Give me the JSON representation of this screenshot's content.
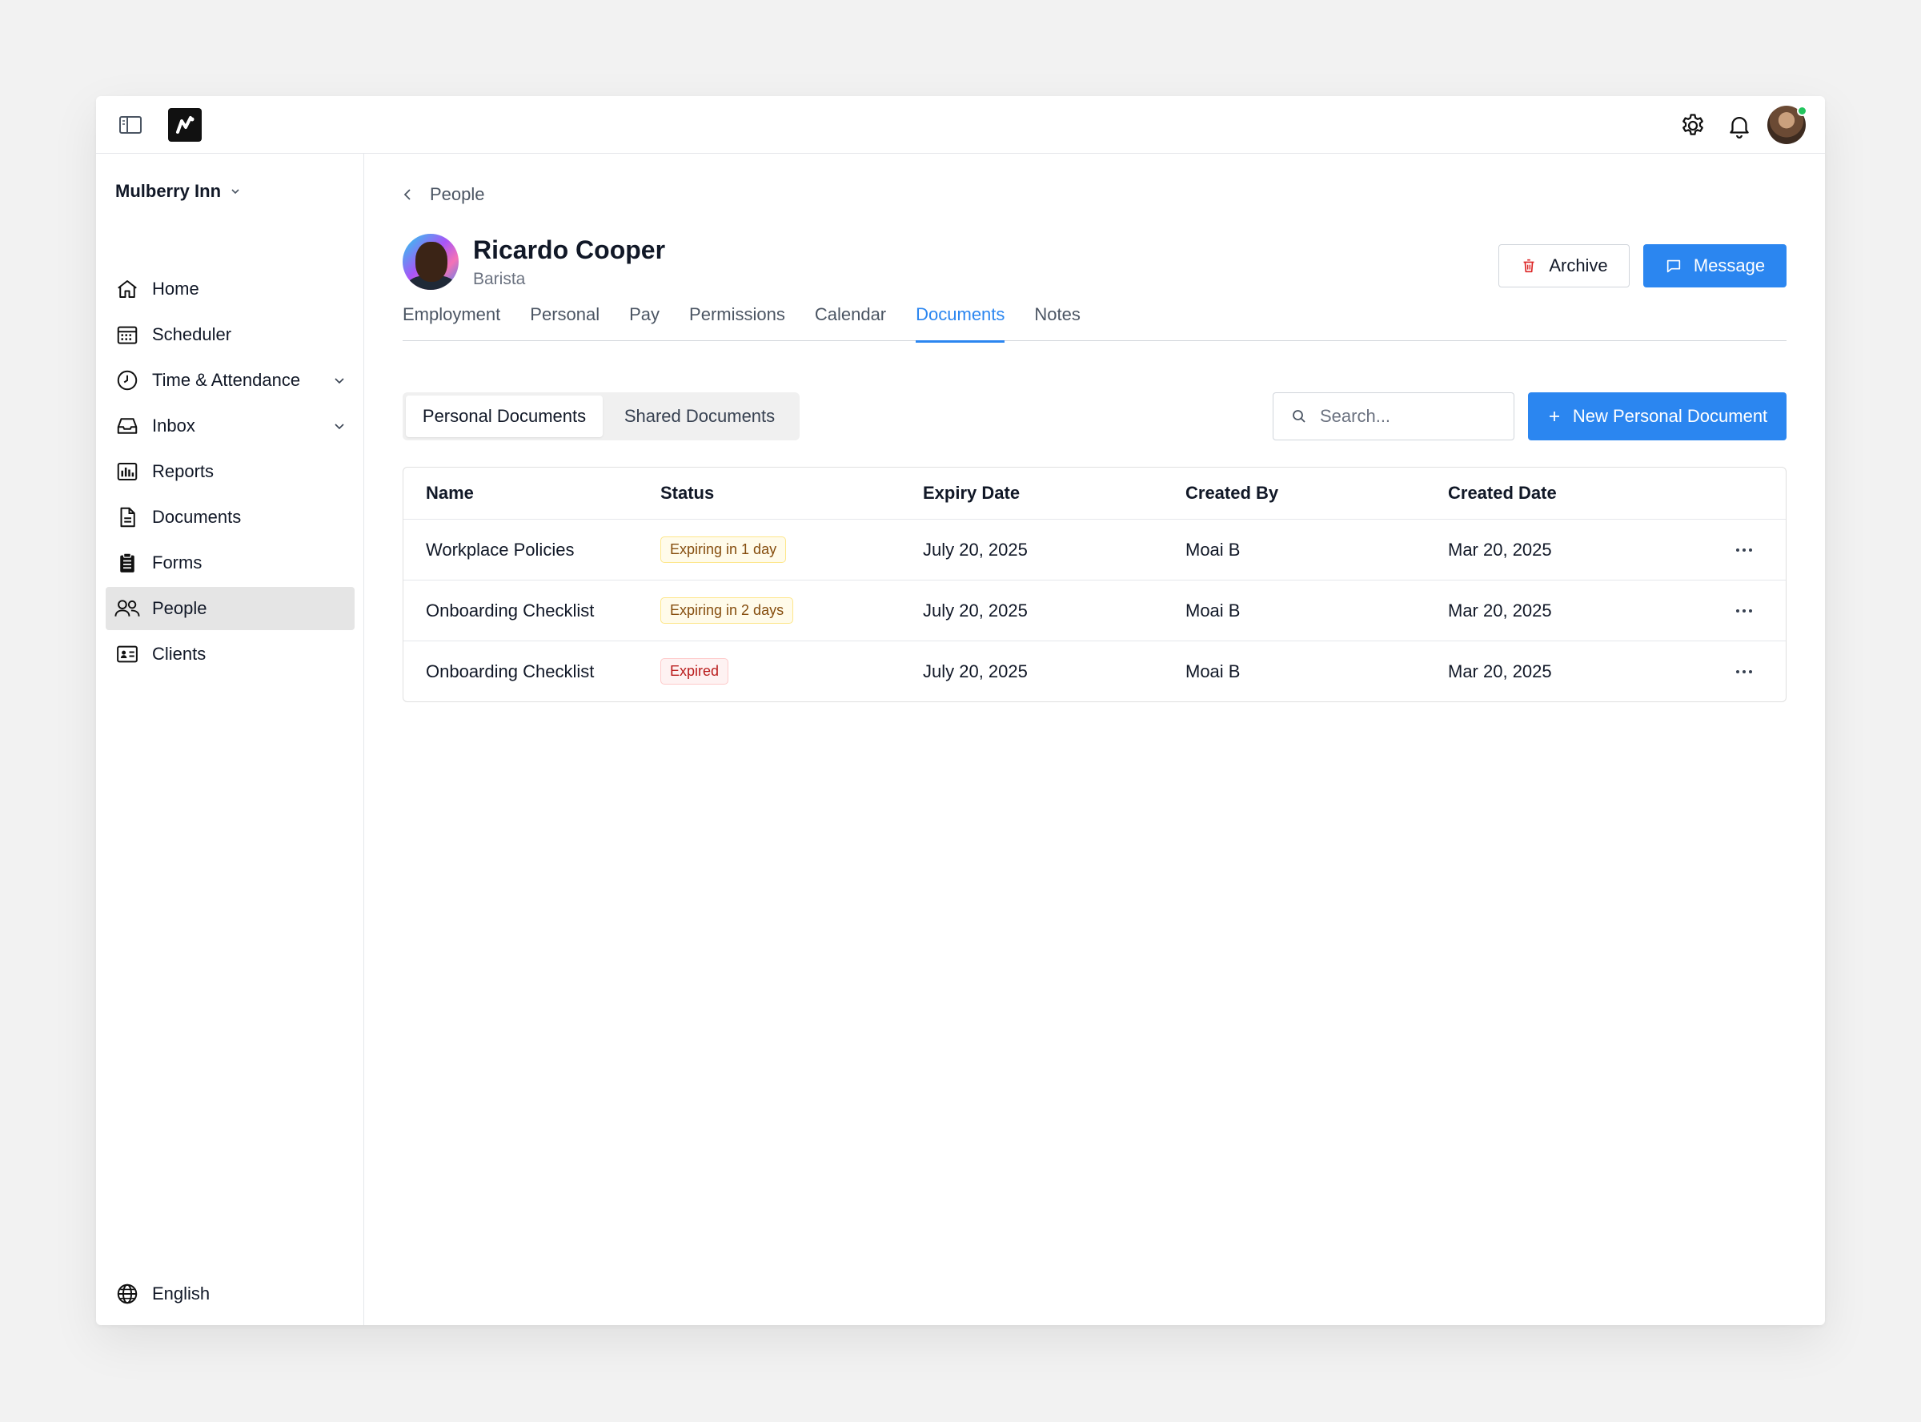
{
  "org": {
    "name": "Mulberry Inn"
  },
  "sidebar": {
    "items": [
      {
        "label": "Home",
        "icon": "home-icon"
      },
      {
        "label": "Scheduler",
        "icon": "calendar-icon"
      },
      {
        "label": "Time & Attendance",
        "icon": "clock-icon",
        "expandable": true
      },
      {
        "label": "Inbox",
        "icon": "inbox-icon",
        "expandable": true
      },
      {
        "label": "Reports",
        "icon": "bar-chart-icon"
      },
      {
        "label": "Documents",
        "icon": "file-icon"
      },
      {
        "label": "Forms",
        "icon": "clipboard-icon"
      },
      {
        "label": "People",
        "icon": "users-icon",
        "active": true
      },
      {
        "label": "Clients",
        "icon": "id-card-icon"
      }
    ],
    "language": "English"
  },
  "breadcrumb": {
    "label": "People"
  },
  "profile": {
    "name": "Ricardo Cooper",
    "role": "Barista"
  },
  "actions": {
    "archive": "Archive",
    "message": "Message"
  },
  "tabs": [
    "Employment",
    "Personal",
    "Pay",
    "Permissions",
    "Calendar",
    "Documents",
    "Notes"
  ],
  "active_tab": "Documents",
  "segments": {
    "personal": "Personal Documents",
    "shared": "Shared Documents",
    "active": "Personal Documents"
  },
  "search": {
    "placeholder": "Search..."
  },
  "new_button": "New Personal Document",
  "table": {
    "headers": [
      "Name",
      "Status",
      "Expiry Date",
      "Created By",
      "Created Date"
    ],
    "rows": [
      {
        "name": "Workplace Policies",
        "status": "Expiring in 1 day",
        "status_type": "warning",
        "expiry": "July 20, 2025",
        "created_by": "Moai B",
        "created": "Mar 20, 2025"
      },
      {
        "name": "Onboarding Checklist",
        "status": "Expiring in 2 days",
        "status_type": "warning",
        "expiry": "July 20, 2025",
        "created_by": "Moai B",
        "created": "Mar 20, 2025"
      },
      {
        "name": "Onboarding Checklist",
        "status": "Expired",
        "status_type": "danger",
        "expiry": "July 20, 2025",
        "created_by": "Moai B",
        "created": "Mar 20, 2025"
      }
    ]
  },
  "colors": {
    "accent": "#2b86f0",
    "online": "#22c55e",
    "danger": "#dc2626"
  }
}
